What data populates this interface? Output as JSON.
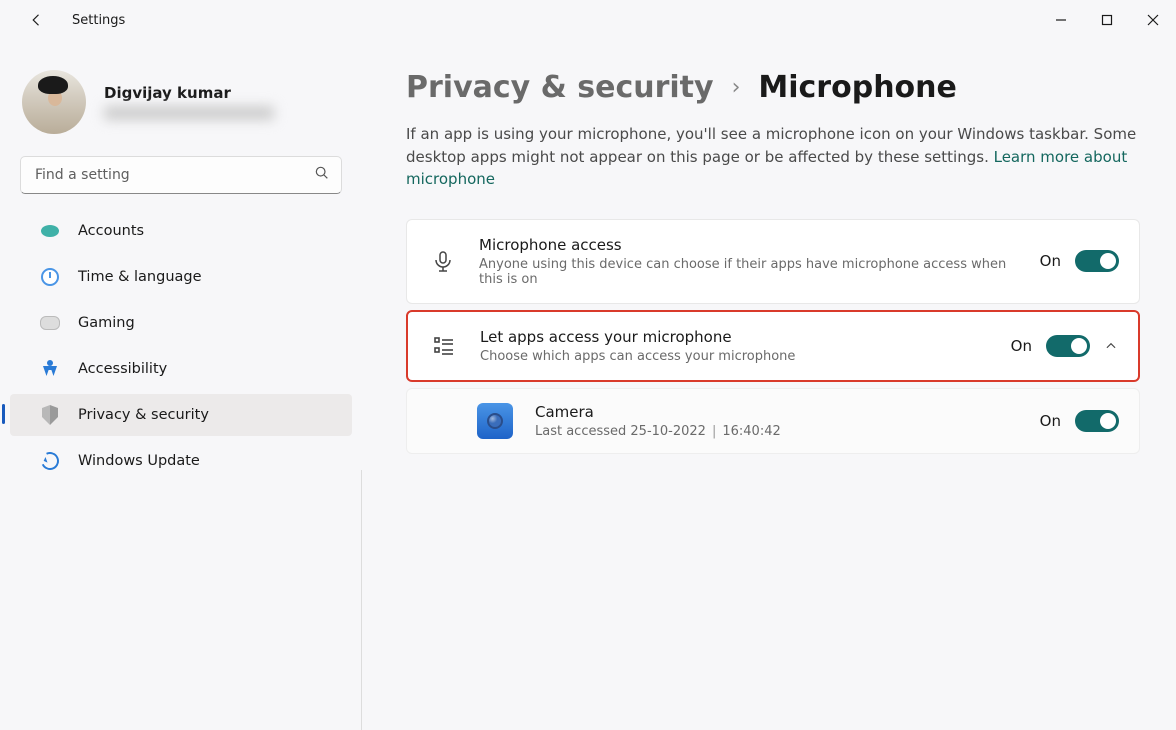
{
  "app_title": "Settings",
  "profile": {
    "name": "Digvijay kumar"
  },
  "search": {
    "placeholder": "Find a setting"
  },
  "sidebar": {
    "items": [
      {
        "label": "Accounts"
      },
      {
        "label": "Time & language"
      },
      {
        "label": "Gaming"
      },
      {
        "label": "Accessibility"
      },
      {
        "label": "Privacy & security"
      },
      {
        "label": "Windows Update"
      }
    ]
  },
  "breadcrumb": {
    "parent": "Privacy & security",
    "sep": "›",
    "current": "Microphone"
  },
  "description": {
    "text": "If an app is using your microphone, you'll see a microphone icon on your Windows taskbar. Some desktop apps might not appear on this page or be affected by these settings.  ",
    "link": "Learn more about microphone"
  },
  "mic_access": {
    "title": "Microphone access",
    "sub": "Anyone using this device can choose if their apps have microphone access when this is on",
    "state": "On"
  },
  "app_access": {
    "title": "Let apps access your microphone",
    "sub": "Choose which apps can access your microphone",
    "state": "On"
  },
  "apps": [
    {
      "name": "Camera",
      "last_prefix": "Last accessed ",
      "last_date": "25-10-2022",
      "last_time": "16:40:42",
      "state": "On"
    }
  ]
}
